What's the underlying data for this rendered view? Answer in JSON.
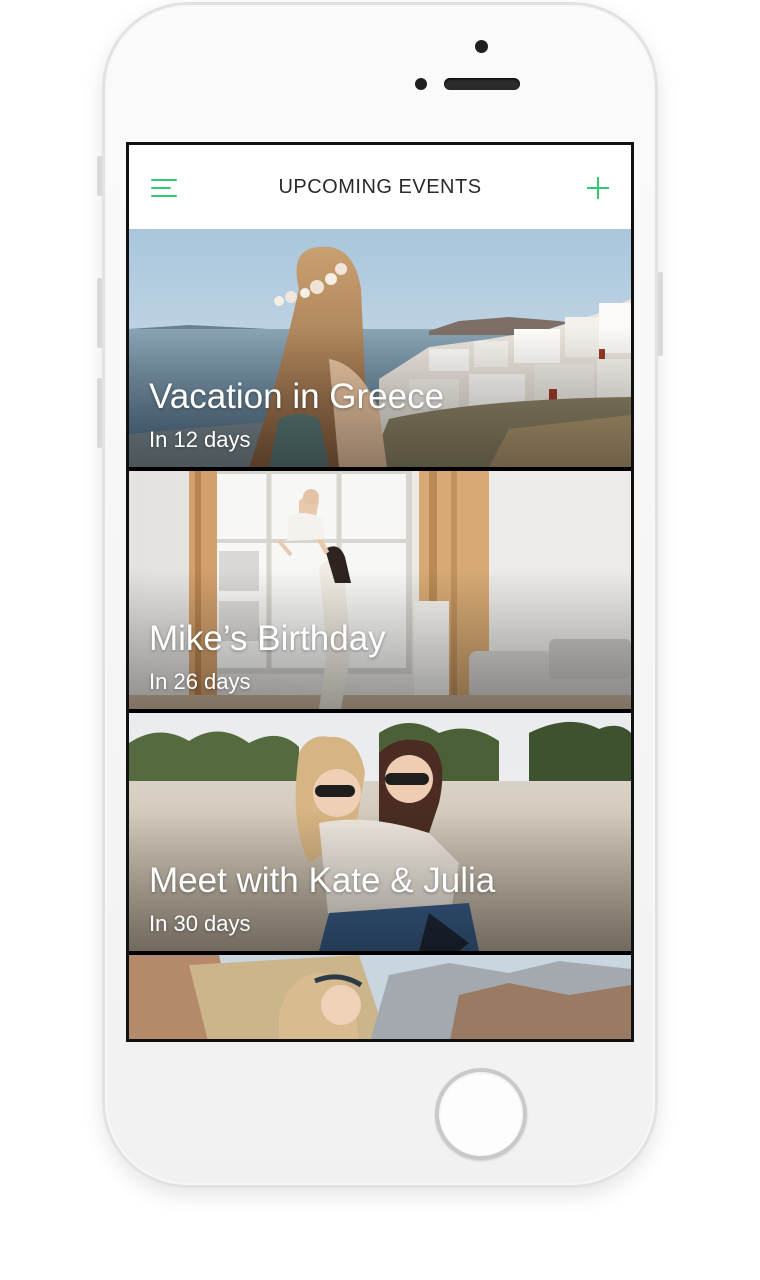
{
  "app": {
    "header": {
      "title": "UPCOMING EVENTS",
      "menu_icon": "hamburger-menu-icon",
      "add_icon": "plus-icon",
      "accent_color": "#2ecc71"
    },
    "events": [
      {
        "title": "Vacation in Greece",
        "subtitle": "In 12 days",
        "scene": "greek seaside with white houses"
      },
      {
        "title": "Mike’s Birthday",
        "subtitle": "In 26 days",
        "scene": "bright room, mother lifting child"
      },
      {
        "title": "Meet with Kate & Julia",
        "subtitle": "In 30 days",
        "scene": "two friends piggyback outdoors"
      },
      {
        "title": "",
        "subtitle": "",
        "scene": "woman in rocky mountain landscape"
      }
    ]
  }
}
